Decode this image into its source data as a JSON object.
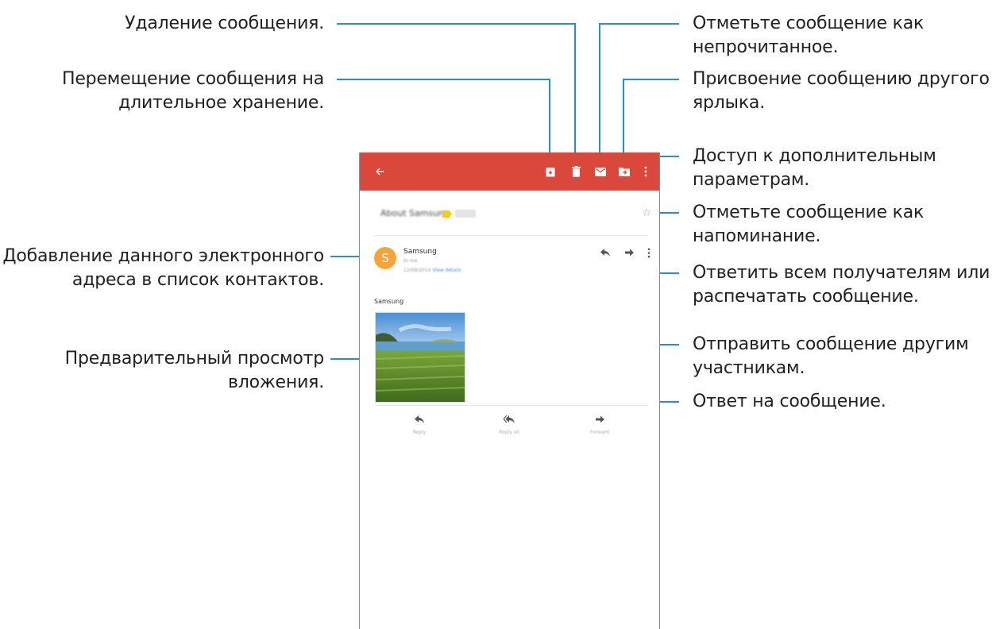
{
  "callouts": {
    "delete": "Удаление сообщения.",
    "archive": [
      "Перемещение сообщения на",
      "длительное хранение."
    ],
    "mark_unread": [
      "Отметьте сообщение как",
      "непрочитанное."
    ],
    "change_label": [
      "Присвоение сообщению другого",
      "ярлыка."
    ],
    "more_options": [
      "Доступ к дополнительным",
      "параметрам."
    ],
    "star": [
      "Отметьте сообщение как",
      "напоминание."
    ],
    "add_contact": [
      "Добавление данного электронного",
      "адреса в список контактов."
    ],
    "reply_all_print": [
      "Ответить всем получателям или",
      "распечатать сообщение."
    ],
    "forward": [
      "Отправить сообщение другим",
      "участникам."
    ],
    "preview": [
      "Предварительный просмотр",
      "вложения."
    ],
    "reply": "Ответ на сообщение."
  },
  "app": {
    "accent_color": "#d9483b",
    "toolbar_icons": [
      "back-arrow-icon",
      "archive-icon",
      "trash-icon",
      "envelope-icon",
      "move-to-folder-icon",
      "more-vert-icon"
    ],
    "subject": "About Samsung",
    "sender": "Samsung",
    "sender_initial": "S",
    "to_line": "to me",
    "date": "12/09/2014",
    "view_details": "View details",
    "body": "Samsung",
    "actions": {
      "reply": "Reply",
      "reply_all": "Reply all",
      "forward": "Forward"
    }
  }
}
